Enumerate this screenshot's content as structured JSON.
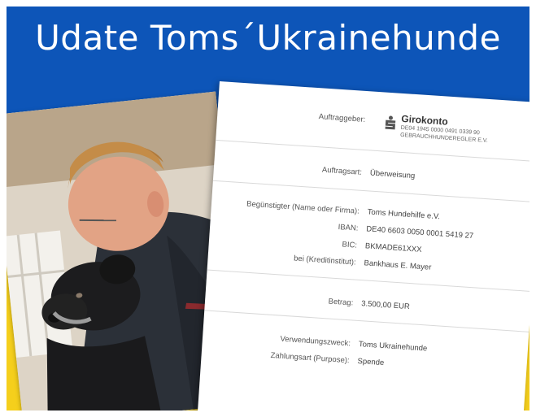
{
  "header": {
    "title": "Udate Toms´Ukrainehunde"
  },
  "colors": {
    "blue": "#0d55b8",
    "yellow": "#f5cf1c"
  },
  "document": {
    "auftraggeber_label": "Auftraggeber:",
    "bank_icon": "sparkasse-s-icon",
    "bank_name": "Girokonto",
    "account_line": "DE04 1945 0000 0491 0339 90",
    "account_holder": "GEBRAUCHHUNDEREGLER E.V.",
    "auftragsart_label": "Auftragsart:",
    "auftragsart_value": "Überweisung",
    "beguenstigter_label": "Begünstigter (Name oder Firma):",
    "beguenstigter_value": "Toms Hundehilfe e.V.",
    "iban_label": "IBAN:",
    "iban_value": "DE40 6603 0050 0001 5419 27",
    "bic_label": "BIC:",
    "bic_value": "BKMADE61XXX",
    "bei_label": "bei (Kreditinstitut):",
    "bei_value": "Bankhaus E. Mayer",
    "betrag_label": "Betrag:",
    "betrag_value": "3.500,00 EUR",
    "verwendungszweck_label": "Verwendungszweck:",
    "verwendungszweck_value": "Toms Ukrainehunde",
    "zahlungsart_label": "Zahlungsart (Purpose):",
    "zahlungsart_value": "Spende"
  }
}
